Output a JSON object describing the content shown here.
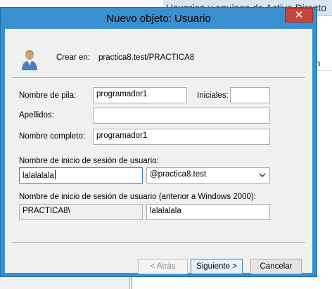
{
  "background_window": {
    "title": "Usuarios y equipos de Active Directo",
    "column_header": "ón"
  },
  "dialog": {
    "title": "Nuevo objeto: Usuario",
    "close_glyph": "✕",
    "create_in_label": "Crear en:",
    "create_in_value": "practica8.test/PRACTICA8",
    "first_name_label": "Nombre de pila:",
    "first_name_value": "programador1",
    "initials_label": "Iniciales:",
    "initials_value": "",
    "last_name_label": "Apellidos:",
    "last_name_value": "",
    "full_name_label": "Nombre completo:",
    "full_name_value": "programador1",
    "logon_name_label": "Nombre de inicio de sesión de usuario:",
    "logon_name_value": "lalalalala",
    "domain_suffix_value": "@practica8.test",
    "pre2000_label": "Nombre de inicio de sesión de usuario (anterior a Windows 2000):",
    "pre2000_domain_value": "PRACTICA8\\",
    "pre2000_name_value": "lalalalala",
    "back_button": "< Atrás",
    "next_button": "Siguiente >",
    "cancel_button": "Cancelar"
  },
  "colors": {
    "titlebar": "#3a8fd0",
    "close_button": "#c9463d",
    "client_bg": "#f0f0f0",
    "focus_border": "#3c7fb1"
  },
  "icons": [
    "user-icon",
    "close-icon",
    "chevron-down-icon"
  ]
}
